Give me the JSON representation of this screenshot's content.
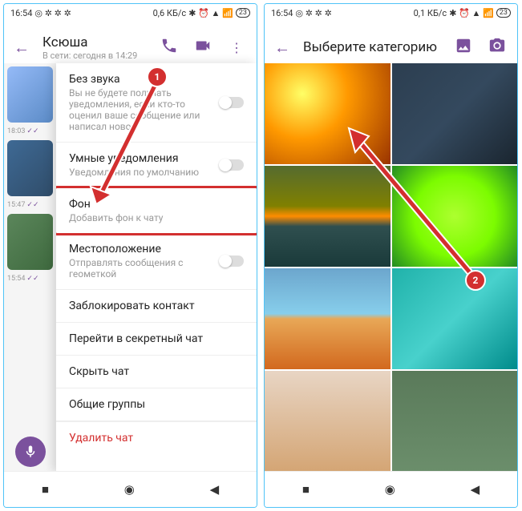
{
  "left": {
    "status": {
      "time": "16:54",
      "data": "0,6 КБ/с",
      "battery": "23"
    },
    "header": {
      "title": "Ксюша",
      "subtitle": "В сети: сегодня в 14:29"
    },
    "timestamps": [
      "18:03",
      "15:47",
      "15:54"
    ],
    "items": [
      {
        "title": "Без звука",
        "sub": "Вы не будете получать уведомления, если кто-то оценил ваше сообщение или написал новое",
        "toggle": true
      },
      {
        "title": "Умные уведомления",
        "sub": "Уведомления по умолчанию",
        "toggle": true
      },
      {
        "title": "Фон",
        "sub": "Добавить фон к чату",
        "highlight": true
      },
      {
        "title": "Местоположение",
        "sub": "Отправлять сообщения с геометкой",
        "toggle": true
      },
      {
        "title": "Заблокировать контакт"
      },
      {
        "title": "Перейти в секретный чат"
      },
      {
        "title": "Скрыть чат"
      },
      {
        "title": "Общие группы"
      },
      {
        "title": "Удалить чат",
        "danger": true
      }
    ],
    "badge": "1"
  },
  "right": {
    "status": {
      "time": "16:54",
      "data": "0,1 КБ/с",
      "battery": "23"
    },
    "header": {
      "title": "Выберите категорию"
    },
    "badge": "2"
  }
}
